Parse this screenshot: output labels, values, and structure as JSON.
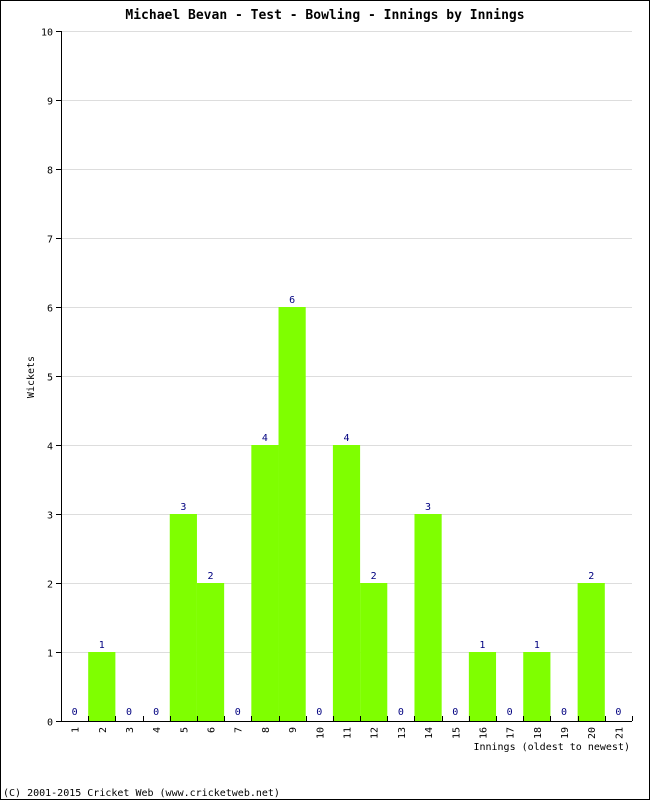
{
  "chart_data": {
    "type": "bar",
    "title": "Michael Bevan - Test - Bowling - Innings by Innings",
    "xlabel": "Innings (oldest to newest)",
    "ylabel": "Wickets",
    "ylim": [
      0,
      10
    ],
    "yticks": [
      "0",
      "1",
      "2",
      "3",
      "4",
      "5",
      "6",
      "7",
      "8",
      "9",
      "10"
    ],
    "grid": true,
    "categories": [
      "1",
      "2",
      "3",
      "4",
      "5",
      "6",
      "7",
      "8",
      "9",
      "10",
      "11",
      "12",
      "13",
      "14",
      "15",
      "16",
      "17",
      "18",
      "19",
      "20",
      "21"
    ],
    "values": [
      0,
      1,
      0,
      0,
      3,
      2,
      0,
      4,
      6,
      0,
      4,
      2,
      0,
      3,
      0,
      1,
      0,
      1,
      0,
      2,
      0
    ],
    "bar_color": "#7fff00",
    "label_color": "#000080",
    "grid_color": "#dddddd"
  },
  "footer": "(C) 2001-2015 Cricket Web (www.cricketweb.net)"
}
